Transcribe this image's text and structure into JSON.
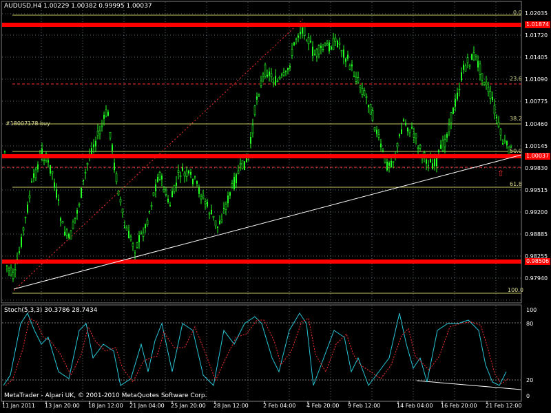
{
  "header": {
    "symbol_info": "AUDUSD,H4  1.00229 1.00382 0.99995 1.00037"
  },
  "price_axis": [
    "1.02035",
    "1.01874",
    "1.01720",
    "1.01405",
    "1.01090",
    "1.00775",
    "1.00460",
    "1.00145",
    "1.00037",
    "0.99830",
    "0.99515",
    "0.99200",
    "0.98885",
    "0.98506",
    "0.98255",
    "0.97940"
  ],
  "time_axis": [
    "11 Jan 2011",
    "13 Jan 20:00",
    "18 Jan 12:00",
    "21 Jan 04:00",
    "25 Jan 20:00",
    "28 Jan 12:00",
    "2 Feb 04:00",
    "4 Feb 20:00",
    "9 Feb 12:00",
    "14 Feb 04:00",
    "16 Feb 20:00",
    "21 Feb 12:00"
  ],
  "fibonacci": {
    "levels": [
      "0.0",
      "23.6",
      "38.2",
      "50.0",
      "61.8",
      "100.0"
    ],
    "colors": {
      "line": "#c8c860",
      "text": "#d8d890"
    }
  },
  "order_label": "#18007178 buy",
  "support_lines": {
    "upper_value": "1.01874",
    "middle_value": "1.00037",
    "lower_value": "0.98506",
    "color": "#ff0000"
  },
  "indicator": {
    "title": "Stoch(5,3,3) 30.3786 28.7434",
    "levels": [
      "100",
      "80",
      "20",
      "0"
    ],
    "main_color": "#28c8d8",
    "signal_color": "#ff3030"
  },
  "footer": "MetaTrader - Alpari UK, © 2001-2010 MetaQuotes Software Corp.",
  "colors": {
    "candles": "#22ff22",
    "grid": "#5a6e78",
    "trendline": "#ffffff"
  }
}
